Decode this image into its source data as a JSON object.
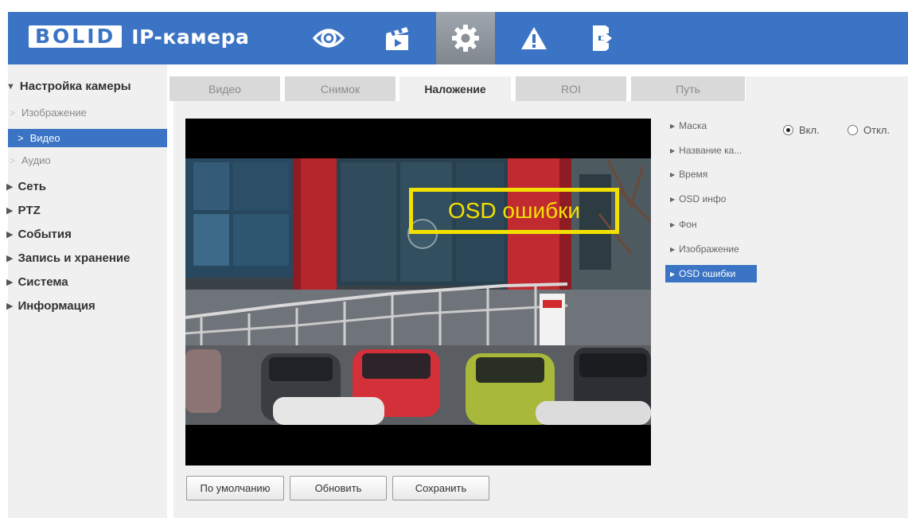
{
  "header": {
    "logo_text": "BOLID",
    "product_name": "IP-камера",
    "nav": [
      "eye-icon",
      "clapperboard-icon",
      "gear-icon",
      "warning-icon",
      "logout-icon"
    ],
    "active_nav": "gear-icon",
    "accent_color": "#3b74c4"
  },
  "sidebar": {
    "camera_settings": "Настройка камеры",
    "sub_items": [
      "Изображение",
      "Видео",
      "Аудио"
    ],
    "selected_sub_item": "Видео",
    "top_items": [
      "Сеть",
      "PTZ",
      "События",
      "Запись и хранение",
      "Система",
      "Информация"
    ]
  },
  "tabs": [
    "Видео",
    "Снимок",
    "Наложение",
    "ROI",
    "Путь"
  ],
  "active_tab": "Наложение",
  "preview": {
    "osd_text": "OSD ошибки",
    "osd_color": "#f2e000"
  },
  "osd_menu": [
    "Маска",
    "Название ка...",
    "Время",
    "OSD инфо",
    "Фон",
    "Изображение",
    "OSD ошибки"
  ],
  "osd_menu_selected": "OSD ошибки",
  "radio": {
    "on_label": "Вкл.",
    "off_label": "Откл.",
    "selected": "Вкл."
  },
  "buttons": {
    "default": "По умолчанию",
    "refresh": "Обновить",
    "save": "Сохранить"
  }
}
